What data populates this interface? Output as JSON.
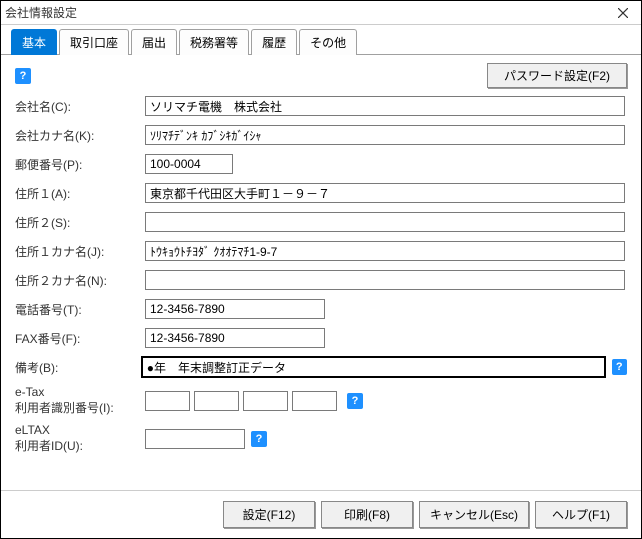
{
  "window": {
    "title": "会社情報設定"
  },
  "tabs": [
    "基本",
    "取引口座",
    "届出",
    "税務署等",
    "履歴",
    "その他"
  ],
  "top": {
    "password_btn": "パスワード設定(F2)"
  },
  "labels": {
    "company": "会社名(C):",
    "company_kana": "会社カナ名(K):",
    "zip": "郵便番号(P):",
    "addr1": "住所１(A):",
    "addr2": "住所２(S):",
    "addr1_kana": "住所１カナ名(J):",
    "addr2_kana": "住所２カナ名(N):",
    "tel": "電話番号(T):",
    "fax": "FAX番号(F):",
    "remarks": "備考(B):",
    "etax_line1": "e-Tax",
    "etax_line2": "利用者識別番号(I):",
    "eltax_line1": "eLTAX",
    "eltax_line2": "利用者ID(U):"
  },
  "values": {
    "company": "ソリマチ電機　株式会社",
    "company_kana": "ｿﾘﾏﾁﾃﾞﾝｷ ｶﾌﾞｼｷｶﾞｲｼｬ",
    "zip": "100-0004",
    "addr1": "東京都千代田区大手町１－９－７",
    "addr2": "",
    "addr1_kana": "ﾄｳｷｮｳﾄﾁﾖﾀﾞ ｸｵｵﾃﾏﾁ1-9-7",
    "addr2_kana": "",
    "tel": "12-3456-7890",
    "fax": "12-3456-7890",
    "remarks": "●年　年末調整訂正データ",
    "etax_1": "",
    "etax_2": "",
    "etax_3": "",
    "etax_4": "",
    "eltax": ""
  },
  "footer": {
    "settei": "設定(F12)",
    "print": "印刷(F8)",
    "cancel": "キャンセル(Esc)",
    "help": "ヘルプ(F1)"
  },
  "icons": {
    "help": "?"
  }
}
